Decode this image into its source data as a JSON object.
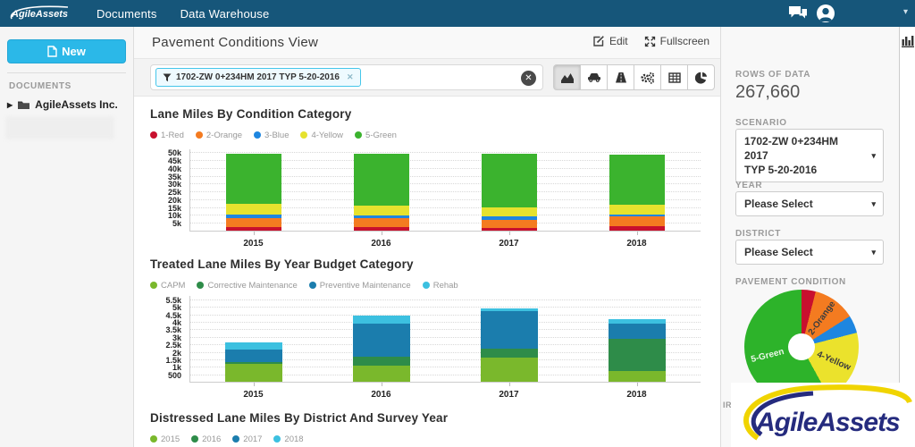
{
  "navbar": {
    "brand": "AgileAssets",
    "menu": [
      {
        "label": "Documents"
      },
      {
        "label": "Data Warehouse"
      }
    ]
  },
  "left_sidebar": {
    "new_button_label": "New",
    "section_title": "DOCUMENTS",
    "tree_items": [
      {
        "label": "AgileAssets Inc."
      }
    ]
  },
  "view_header": {
    "title": "Pavement Conditions View",
    "edit_label": "Edit",
    "fullscreen_label": "Fullscreen"
  },
  "filter_bar": {
    "chip_text": "1702-ZW 0+234HM 2017 TYP 5-20-2016",
    "toolbar_icons": [
      "area-chart",
      "car",
      "road",
      "gears",
      "table",
      "pie-chart"
    ],
    "active_toolbar_icon": "area-chart"
  },
  "right_panel": {
    "rows_of_data_label": "ROWS OF DATA",
    "rows_of_data_value": "267,660",
    "scenario_label": "SCENARIO",
    "scenario_value_line1": "1702-ZW 0+234HM 2017",
    "scenario_value_line2": "TYP 5-20-2016",
    "year_label": "YEAR",
    "year_value": "Please Select",
    "district_label": "DISTRICT",
    "district_value": "Please Select",
    "pavement_condition_label": "PAVEMENT CONDITION",
    "partial_text": "IR"
  },
  "watermark_text": "AgileAssets",
  "chart_data": [
    {
      "type": "bar",
      "stacked": true,
      "title": "Lane Miles By Condition Category",
      "categories": [
        "2015",
        "2016",
        "2017",
        "2018"
      ],
      "ymax": 52500,
      "yticks": [
        {
          "v": 5000,
          "label": "5k"
        },
        {
          "v": 10000,
          "label": "10k"
        },
        {
          "v": 15000,
          "label": "15k"
        },
        {
          "v": 20000,
          "label": "20k"
        },
        {
          "v": 25000,
          "label": "25k"
        },
        {
          "v": 30000,
          "label": "30k"
        },
        {
          "v": 35000,
          "label": "35k"
        },
        {
          "v": 40000,
          "label": "40k"
        },
        {
          "v": 45000,
          "label": "45k"
        },
        {
          "v": 50000,
          "label": "50k"
        }
      ],
      "series": [
        {
          "name": "1-Red",
          "color": "#c8102e",
          "values": [
            2500,
            2500,
            2000,
            3000
          ]
        },
        {
          "name": "2-Orange",
          "color": "#f47b20",
          "values": [
            5500,
            5500,
            5000,
            6000
          ]
        },
        {
          "name": "3-Blue",
          "color": "#1e86e0",
          "values": [
            2500,
            2000,
            2000,
            1500
          ]
        },
        {
          "name": "4-Yellow",
          "color": "#e6e22e",
          "values": [
            6500,
            6000,
            6000,
            6000
          ]
        },
        {
          "name": "5-Green",
          "color": "#3bb32e",
          "values": [
            32000,
            33000,
            34000,
            32000
          ]
        }
      ]
    },
    {
      "type": "bar",
      "stacked": true,
      "title": "Treated Lane Miles By Year Budget Category",
      "categories": [
        "2015",
        "2016",
        "2017",
        "2018"
      ],
      "ymax": 5800,
      "yticks": [
        {
          "v": 500,
          "label": "500"
        },
        {
          "v": 1000,
          "label": "1k"
        },
        {
          "v": 1500,
          "label": "1.5k"
        },
        {
          "v": 2000,
          "label": "2k"
        },
        {
          "v": 2500,
          "label": "2.5k"
        },
        {
          "v": 3000,
          "label": "3k"
        },
        {
          "v": 3500,
          "label": "3.5k"
        },
        {
          "v": 4000,
          "label": "4k"
        },
        {
          "v": 4500,
          "label": "4.5k"
        },
        {
          "v": 5000,
          "label": "5k"
        },
        {
          "v": 5500,
          "label": "5.5k"
        }
      ],
      "series": [
        {
          "name": "CAPM",
          "color": "#7ab82c",
          "values": [
            1200,
            1050,
            1600,
            700
          ]
        },
        {
          "name": "Corrective Maintenance",
          "color": "#2e8c49",
          "values": [
            100,
            650,
            600,
            2200
          ]
        },
        {
          "name": "Preventive Maintenance",
          "color": "#1b7dad",
          "values": [
            850,
            2200,
            2500,
            1000
          ]
        },
        {
          "name": "Rehab",
          "color": "#3cc0e0",
          "values": [
            500,
            500,
            200,
            300
          ]
        }
      ]
    },
    {
      "type": "bar",
      "stacked": true,
      "title": "Distressed Lane Miles By District And Survey Year",
      "series": [
        {
          "name": "2015",
          "color": "#7ab82c"
        },
        {
          "name": "2016",
          "color": "#2e8c49"
        },
        {
          "name": "2017",
          "color": "#1b7dad"
        },
        {
          "name": "2018",
          "color": "#3cc0e0"
        }
      ]
    },
    {
      "type": "pie",
      "donut": true,
      "title": "PAVEMENT CONDITION",
      "slices": [
        {
          "name": "1-Red",
          "pct": 4,
          "color": "#c8102e"
        },
        {
          "name": "2-Orange",
          "pct": 12,
          "color": "#f47b20",
          "label_color": "#3d3d3d"
        },
        {
          "name": "3-Blue",
          "pct": 5,
          "color": "#1e86e0"
        },
        {
          "name": "4-Yellow",
          "pct": 21,
          "color": "#ebe22c",
          "label_color": "#3d3d3d"
        },
        {
          "name": "5-Green",
          "pct": 58,
          "color": "#2db32a",
          "label_color": "#e9f6e7"
        }
      ]
    }
  ]
}
